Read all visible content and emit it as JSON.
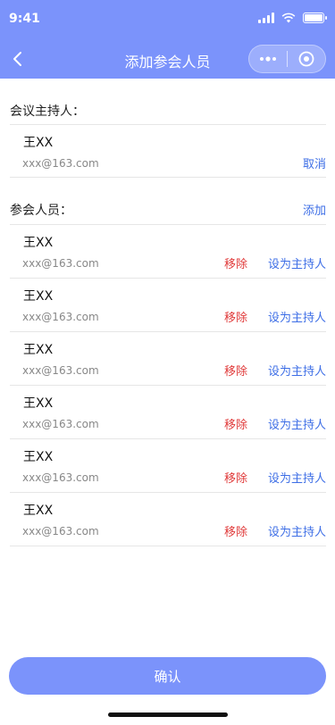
{
  "status_bar": {
    "time": "9:41"
  },
  "nav": {
    "title": "添加参会人员"
  },
  "host_section": {
    "label": "会议主持人：",
    "host": {
      "name": "王XX",
      "email": "xxx@163.com",
      "cancel_label": "取消"
    }
  },
  "attendee_section": {
    "label": "参会人员：",
    "add_label": "添加",
    "remove_label": "移除",
    "set_host_label": "设为主持人",
    "attendees": [
      {
        "name": "王XX",
        "email": "xxx@163.com"
      },
      {
        "name": "王XX",
        "email": "xxx@163.com"
      },
      {
        "name": "王XX",
        "email": "xxx@163.com"
      },
      {
        "name": "王XX",
        "email": "xxx@163.com"
      },
      {
        "name": "王XX",
        "email": "xxx@163.com"
      },
      {
        "name": "王XX",
        "email": "xxx@163.com"
      }
    ]
  },
  "confirm_label": "确认",
  "colors": {
    "brand": "#7b93fb",
    "link": "#3d6ee6",
    "danger": "#e03a3a"
  }
}
